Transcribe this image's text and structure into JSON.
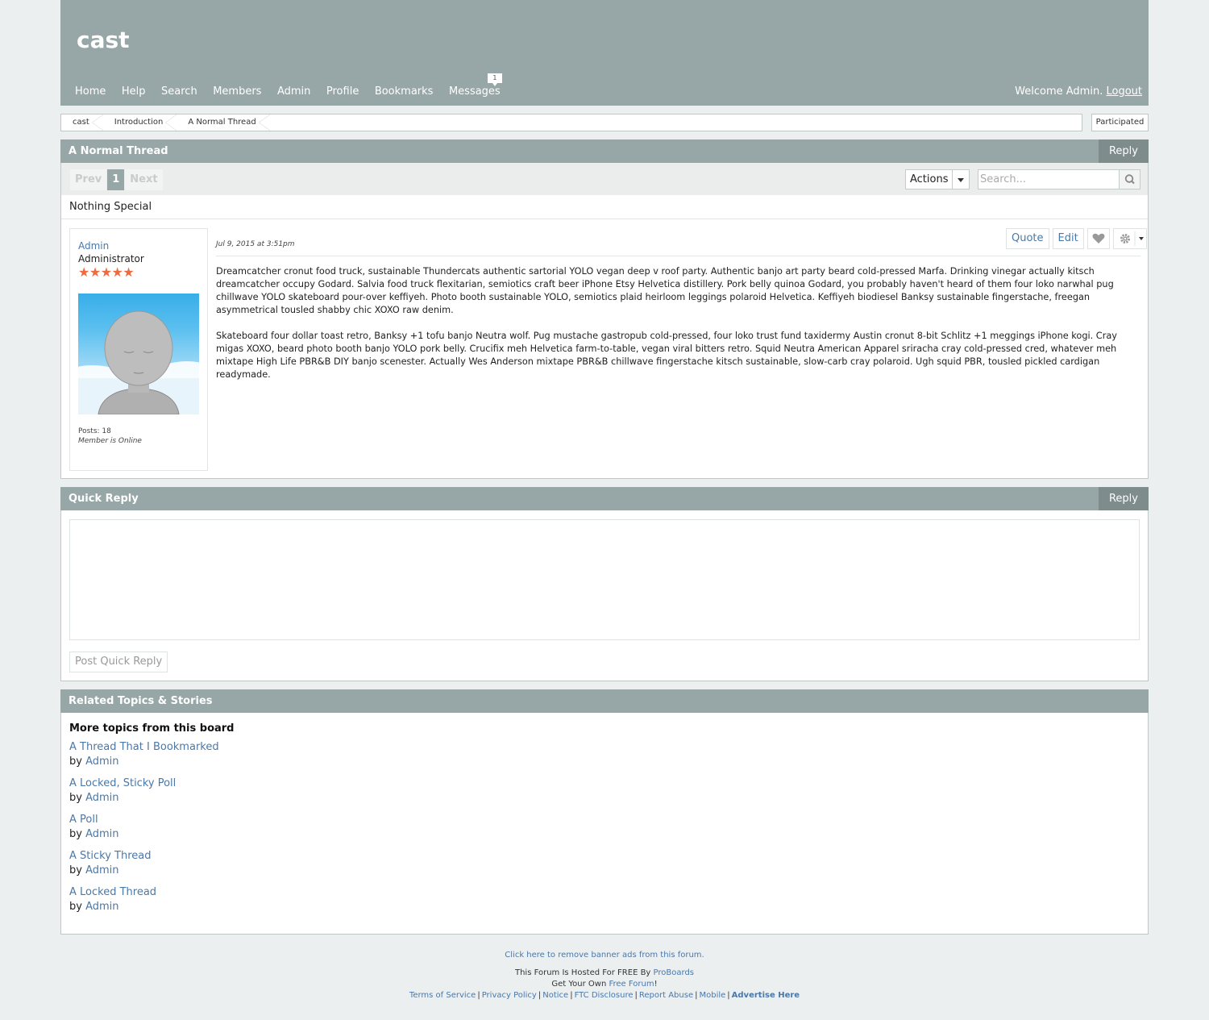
{
  "site": {
    "title": "cast"
  },
  "nav": {
    "items": [
      "Home",
      "Help",
      "Search",
      "Members",
      "Admin",
      "Profile",
      "Bookmarks",
      "Messages"
    ],
    "messages_badge": "1",
    "welcome": "Welcome Admin.",
    "logout": "Logout"
  },
  "breadcrumb": [
    "cast",
    "Introduction",
    "A Normal Thread"
  ],
  "participated": "Participated",
  "thread": {
    "title": "A Normal Thread",
    "reply": "Reply",
    "pager": {
      "prev": "Prev",
      "current": "1",
      "next": "Next"
    },
    "actions": "Actions",
    "search_placeholder": "Search...",
    "description": "Nothing Special"
  },
  "post": {
    "author": "Admin",
    "rank": "Administrator",
    "stars": 5,
    "posts": "Posts: 18",
    "status": "Member is Online",
    "date": "Jul 9, 2015 at 3:51pm",
    "quote": "Quote",
    "edit": "Edit",
    "body": [
      "Dreamcatcher cronut food truck, sustainable Thundercats authentic sartorial YOLO vegan deep v roof party. Authentic banjo art party beard cold-pressed Marfa. Drinking vinegar actually kitsch dreamcatcher occupy Godard. Salvia food truck flexitarian, semiotics craft beer iPhone Etsy Helvetica distillery. Pork belly quinoa Godard, you probably haven't heard of them four loko narwhal pug chillwave YOLO skateboard pour-over keffiyeh. Photo booth sustainable YOLO, semiotics plaid heirloom leggings polaroid Helvetica. Keffiyeh biodiesel Banksy sustainable fingerstache, freegan asymmetrical tousled shabby chic XOXO raw denim.",
      "Skateboard four dollar toast retro, Banksy +1 tofu banjo Neutra wolf. Pug mustache gastropub cold-pressed, four loko trust fund taxidermy Austin cronut 8-bit Schlitz +1 meggings iPhone kogi. Cray migas XOXO, beard photo booth banjo YOLO pork belly. Crucifix meh Helvetica farm-to-table, vegan viral bitters retro. Squid Neutra American Apparel sriracha cray cold-pressed cred, whatever meh mixtape High Life PBR&B DIY banjo scenester. Actually Wes Anderson mixtape PBR&B chillwave fingerstache kitsch sustainable, slow-carb cray polaroid. Ugh squid PBR, tousled pickled cardigan readymade."
    ]
  },
  "quick_reply": {
    "title": "Quick Reply",
    "reply": "Reply",
    "submit": "Post Quick Reply"
  },
  "related": {
    "title": "Related Topics & Stories",
    "heading": "More topics from this board",
    "by": "by",
    "items": [
      {
        "title": "A Thread That I Bookmarked",
        "author": "Admin"
      },
      {
        "title": "A Locked, Sticky Poll",
        "author": "Admin"
      },
      {
        "title": "A Poll",
        "author": "Admin"
      },
      {
        "title": "A Sticky Thread",
        "author": "Admin"
      },
      {
        "title": "A Locked Thread",
        "author": "Admin"
      }
    ]
  },
  "footer": {
    "remove_ads": "Click here to remove banner ads from this forum.",
    "hosted_prefix": "This Forum Is Hosted For FREE By",
    "hosted_link": "ProBoards",
    "own_prefix": "Get Your Own",
    "own_link": "Free Forum",
    "own_suffix": "!",
    "links": [
      "Terms of Service",
      "Privacy Policy",
      "Notice",
      "FTC Disclosure",
      "Report Abuse",
      "Mobile"
    ],
    "advertise": "Advertise Here"
  },
  "colors": {
    "header": "#97a6a6",
    "link": "#4a78a8",
    "star": "#f06a40",
    "background": "#eceff0"
  },
  "icons": [
    "search-icon",
    "heart-icon",
    "gear-icon",
    "chevron-down-icon",
    "star-icon"
  ]
}
